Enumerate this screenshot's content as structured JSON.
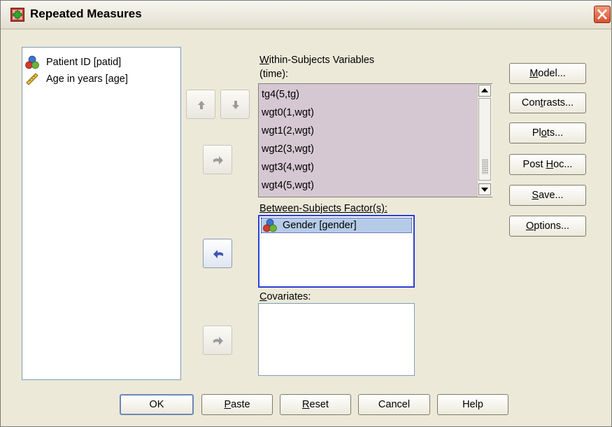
{
  "window": {
    "title": "Repeated Measures",
    "close_glyph": "×",
    "icon": "spss-dialog-icon"
  },
  "source_list": {
    "items": [
      {
        "label": "Patient ID [patid]",
        "icon": "nominal-icon"
      },
      {
        "label": "Age in years [age]",
        "icon": "scale-ruler-icon"
      }
    ]
  },
  "within": {
    "label_line1": "Within-Subjects Variables",
    "label_line2": "(time):",
    "items": [
      "tg4(5,tg)",
      "wgt0(1,wgt)",
      "wgt1(2,wgt)",
      "wgt2(3,wgt)",
      "wgt3(4,wgt)",
      "wgt4(5,wgt)"
    ]
  },
  "between": {
    "label": "Between-Subjects Factor(s):",
    "items": [
      {
        "label": "Gender [gender]",
        "icon": "nominal-icon"
      }
    ]
  },
  "covariates": {
    "label": "Covariates:",
    "items": []
  },
  "side_buttons": [
    {
      "pre": "",
      "ul": "M",
      "post": "odel..."
    },
    {
      "pre": "Con",
      "ul": "t",
      "post": "rasts..."
    },
    {
      "pre": "Pl",
      "ul": "o",
      "post": "ts..."
    },
    {
      "pre": "Post ",
      "ul": "H",
      "post": "oc..."
    },
    {
      "pre": "",
      "ul": "S",
      "post": "ave..."
    },
    {
      "pre": "",
      "ul": "O",
      "post": "ptions..."
    }
  ],
  "bottom_buttons": [
    {
      "pre": "OK",
      "ul": "",
      "post": ""
    },
    {
      "pre": "",
      "ul": "P",
      "post": "aste"
    },
    {
      "pre": "",
      "ul": "R",
      "post": "eset"
    },
    {
      "pre": "Cancel",
      "ul": "",
      "post": ""
    },
    {
      "pre": "Help",
      "ul": "",
      "post": ""
    }
  ],
  "colors": {
    "dialog_bg": "#ece9d8",
    "within_bg": "#d6c8d2",
    "selection_bg": "#b6cbe8",
    "selection_border": "#2a3fd8"
  }
}
